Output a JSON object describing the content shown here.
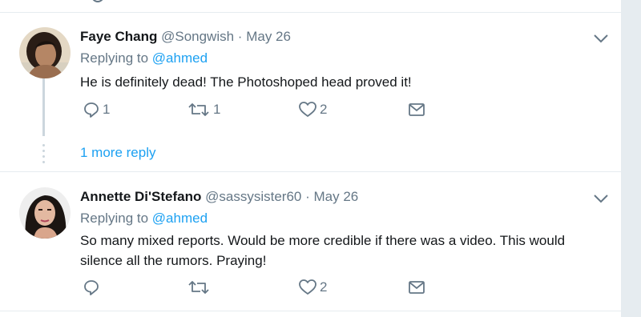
{
  "tweets": [
    {
      "name": "Faye Chang",
      "handle": "@Songwish",
      "separator": "·",
      "date": "May 26",
      "replying_prefix": "Replying to",
      "replying_to": "@ahmed",
      "text": "He is definitely dead! The Photoshoped head proved it!",
      "reply_count": "1",
      "retweet_count": "1",
      "like_count": "2"
    },
    {
      "name": "Annette Di'Stefano",
      "handle": "@sassysister60",
      "separator": "·",
      "date": "May 26",
      "replying_prefix": "Replying to",
      "replying_to": "@ahmed",
      "text": "So many mixed reports. Would be more credible if there was a video. This would silence all the rumors. Praying!",
      "reply_count": "",
      "retweet_count": "",
      "like_count": "2"
    }
  ],
  "more_replies_label": "1 more reply",
  "icons": [
    "reply-icon",
    "retweet-icon",
    "like-icon",
    "direct-message-icon",
    "chevron-down-icon"
  ],
  "colors": {
    "link": "#1da1f2",
    "muted": "#657786",
    "text": "#14171a",
    "divider": "#e6ecf0"
  }
}
